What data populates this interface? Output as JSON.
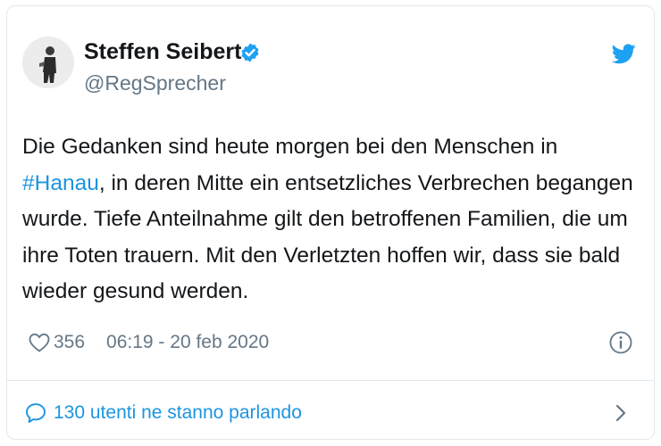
{
  "author": {
    "name": "Steffen Seibert",
    "handle": "@RegSprecher",
    "avatar_icon": "user-photo-icon",
    "verified_icon": "verified-badge-icon"
  },
  "tweet": {
    "text_before": "Die Gedanken sind heute morgen bei den Menschen in ",
    "hashtag": "#Hanau",
    "text_after": ", in deren Mitte ein entsetzliches Verbrechen begangen wurde. Tiefe Anteilnahme gilt den betroffenen Familien, die um ihre Toten trauern. Mit den Verletzten hoffen wir, dass sie bald wieder gesund werden."
  },
  "meta": {
    "like_count": "356",
    "timestamp": "06:19 - 20 feb 2020",
    "heart_icon": "heart-icon",
    "info_icon": "info-icon"
  },
  "conversation": {
    "label": "130 utenti ne stanno parlando",
    "bubble_icon": "speech-bubble-icon",
    "chevron_icon": "chevron-right-icon"
  },
  "brand": {
    "logo_icon": "twitter-bird-icon",
    "twitter_blue": "#1da1f2",
    "link_blue": "#1b95e0",
    "text_color": "#14171a",
    "muted_color": "#657786",
    "border_color": "#e1e8ed"
  }
}
